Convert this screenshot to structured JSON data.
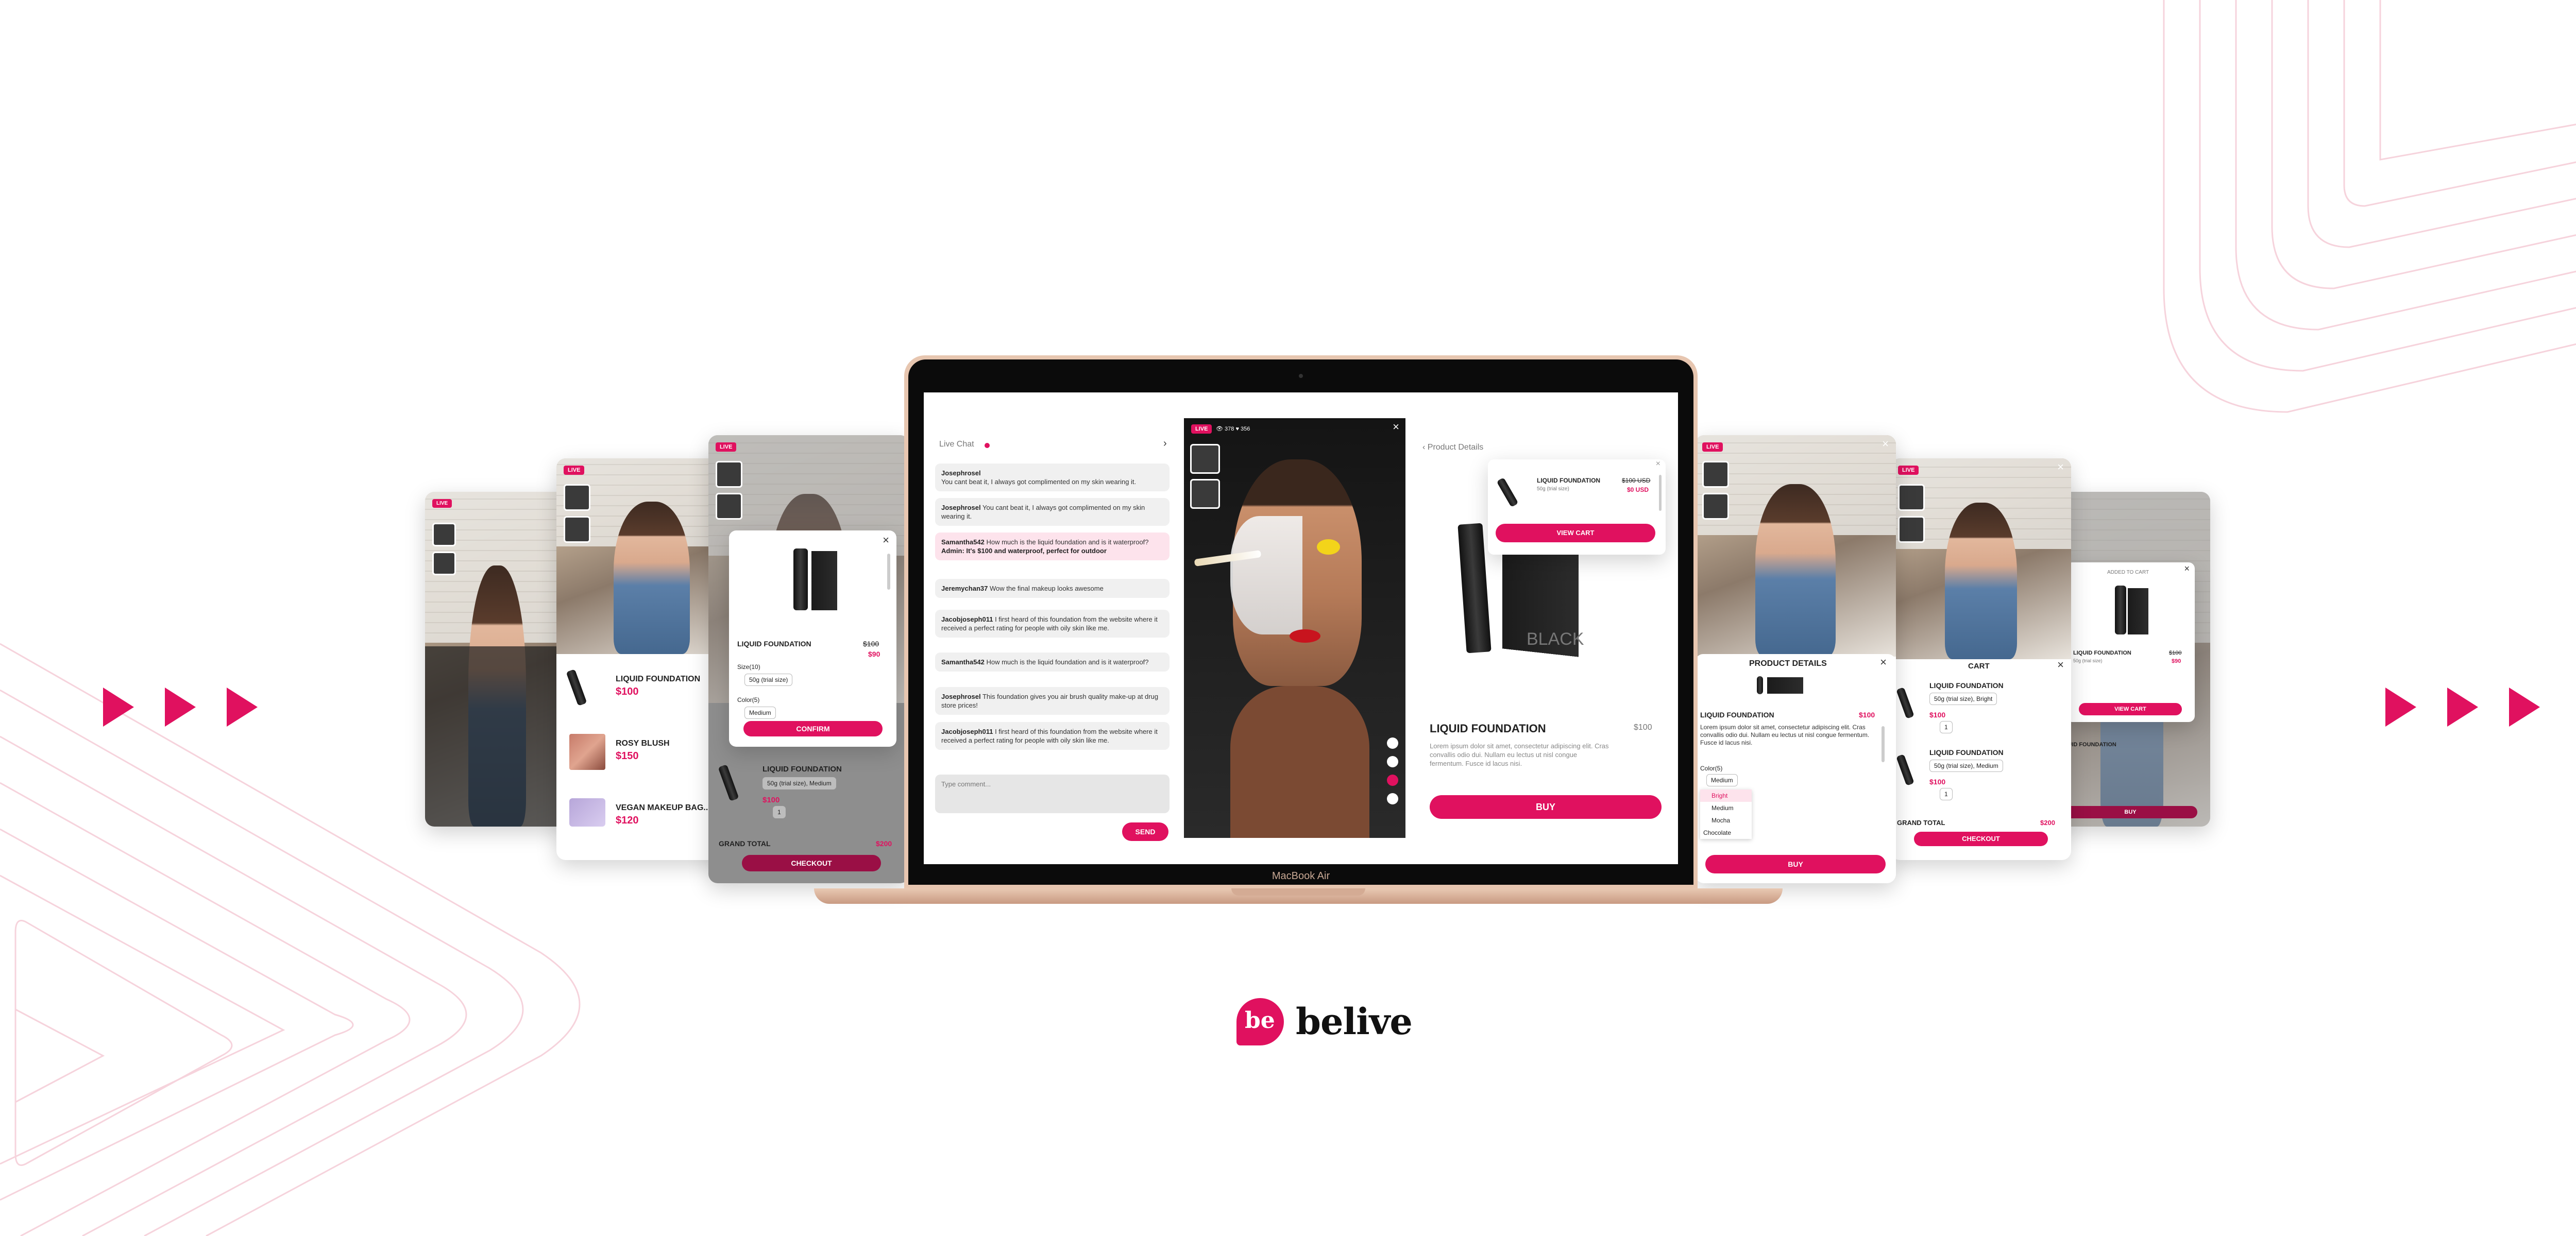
{
  "colors": {
    "accent": "#e0115f",
    "laptop_gold": "#e7c6b0"
  },
  "laptop": {
    "brand_label": "MacBook Air",
    "chat": {
      "title": "Live Chat",
      "messages": [
        {
          "user": "Josephrosel",
          "text": "You cant beat it, I always got complimented on my skin wearing it."
        },
        {
          "user": "Josephrosel",
          "text": "You cant beat it, I always got complimented on my skin wearing it."
        },
        {
          "user": "Samantha542",
          "text": "How much is the liquid foundation and is it waterproof?",
          "reply": "Admin: It's $100 and waterproof, perfect for outdoor"
        },
        {
          "user": "Jeremychan37",
          "text": "Wow the final makeup looks awesome"
        },
        {
          "user": "Jacobjoseph011",
          "text": "I first heard of this foundation from the website where it received a perfect rating for people with oily skin like me."
        },
        {
          "user": "Samantha542",
          "text": "How much is the liquid foundation and is it waterproof?"
        },
        {
          "user": "Josephrosel",
          "text": "This foundation gives you air brush quality make-up at drug store prices!"
        },
        {
          "user": "Jacobjoseph011",
          "text": "I first heard of this foundation from the website where it received a perfect rating for people with oily skin like me."
        }
      ],
      "input_placeholder": "Type comment...",
      "send_label": "SEND"
    },
    "video": {
      "live_label": "LIVE",
      "viewers": "378",
      "likes": "356"
    },
    "product": {
      "back_label": "Product Details",
      "name": "LIQUID FOUNDATION",
      "price": "$100",
      "description": "Lorem ipsum dolor sit amet, consectetur adipiscing elit. Cras convallis odio dui. Nullam eu lectus ut nisl congue fermentum. Fusce id lacus nisi.",
      "buy_label": "BUY",
      "popup": {
        "name": "LIQUID FOUNDATION",
        "old_price": "$100 USD",
        "new_price": "$0 USD",
        "variant": "50g (trial size)",
        "view_cart_label": "VIEW CART"
      },
      "box_text": "BLACK"
    }
  },
  "left_cards": {
    "card2": {
      "items": [
        {
          "name": "LIQUID FOUNDATION",
          "price": "$100"
        },
        {
          "name": "ROSY BLUSH",
          "price": "$150"
        },
        {
          "name": "VEGAN MAKEUP BAG...",
          "price": "$120"
        }
      ]
    },
    "card3": {
      "popup": {
        "name": "LIQUID FOUNDATION",
        "old_price": "$100",
        "new_price": "$90",
        "size_label": "Size(10)",
        "size_value": "50g (trial size)",
        "color_label": "Color(5)",
        "color_value": "Medium",
        "confirm_label": "CONFIRM"
      },
      "cart_item": {
        "name": "LIQUID FOUNDATION",
        "variant": "50g (trial size), Medium",
        "price": "$100",
        "qty": "1"
      },
      "grand_total_label": "GRAND TOTAL",
      "grand_total": "$200",
      "checkout_label": "CHECKOUT"
    }
  },
  "right_cards": {
    "card1": {
      "title": "PRODUCT DETAILS",
      "name": "LIQUID FOUNDATION",
      "price": "$100",
      "description": "Lorem ipsum dolor sit amet, consectetur adipiscing elit. Cras convallis odio dui. Nullam eu lectus ut nisl congue fermentum. Fusce id lacus nisi.",
      "color_label": "Color(5)",
      "color_value": "Medium",
      "options": [
        "Bright",
        "Medium",
        "Mocha",
        "Chocolate"
      ],
      "buy_label": "BUY"
    },
    "card2": {
      "title": "CART",
      "items": [
        {
          "name": "LIQUID FOUNDATION",
          "variant": "50g (trial size), Bright",
          "price": "$100",
          "qty": "1"
        },
        {
          "name": "LIQUID FOUNDATION",
          "variant": "50g (trial size), Medium",
          "price": "$100",
          "qty": "1"
        }
      ],
      "grand_total_label": "GRAND TOTAL",
      "grand_total": "$200",
      "checkout_label": "CHECKOUT"
    },
    "card3": {
      "added_label": "ADDED TO CART",
      "name": "LIQUID FOUNDATION",
      "old_price": "$100",
      "new_price": "$90",
      "variant": "50g (trial size)",
      "view_cart_label": "VIEW CART",
      "buy_label": "BUY"
    }
  },
  "logo": {
    "mark": "be",
    "wordmark": "belive"
  }
}
